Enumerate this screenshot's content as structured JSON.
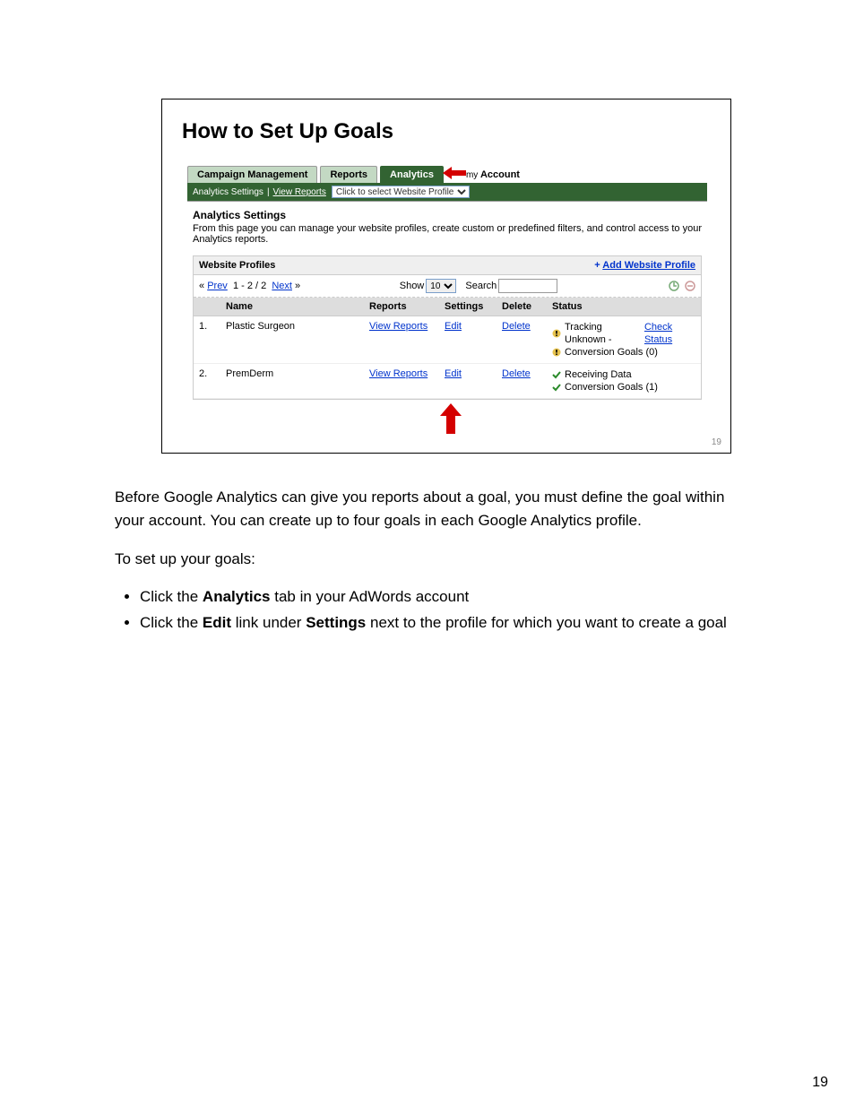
{
  "slide": {
    "title": "How to Set Up Goals",
    "page_label": "19",
    "tabs": [
      "Campaign Management",
      "Reports",
      "Analytics",
      "Account"
    ],
    "active_tab_index": 2,
    "my_prefix": "my",
    "subbar": {
      "settings": "Analytics Settings",
      "view_reports": "View Reports",
      "select_label": "Click to select Website Profile"
    },
    "section": {
      "heading": "Analytics Settings",
      "desc": "From this page you can manage your website profiles, create custom or predefined filters, and control access to your Analytics reports."
    },
    "profiles_table": {
      "header": "Website Profiles",
      "add_link": "Add Website Profile",
      "add_plus": "+",
      "pager": {
        "prev": "Prev",
        "range": "1 - 2 / 2",
        "next": "Next",
        "lq": "«",
        "rq": "»"
      },
      "show_label": "Show",
      "show_value": "10",
      "search_label": "Search",
      "cols": {
        "num": "",
        "name": "Name",
        "reports": "Reports",
        "settings": "Settings",
        "delete": "Delete",
        "status": "Status"
      },
      "rows": [
        {
          "num": "1.",
          "name": "Plastic Surgeon",
          "reports": "View Reports",
          "settings": "Edit",
          "delete": "Delete",
          "status": [
            {
              "kind": "warn",
              "text": "Tracking Unknown -",
              "link": "Check Status"
            },
            {
              "kind": "warn",
              "text": "Conversion Goals (0)"
            }
          ]
        },
        {
          "num": "2.",
          "name": "PremDerm",
          "reports": "View Reports",
          "settings": "Edit",
          "delete": "Delete",
          "status": [
            {
              "kind": "ok",
              "text": "Receiving Data"
            },
            {
              "kind": "ok",
              "text": "Conversion Goals (1)"
            }
          ]
        }
      ]
    }
  },
  "body": {
    "para1": "Before Google Analytics can give you reports about a goal, you must define the goal within your account. You can create up to four goals in each Google Analytics profile.",
    "para2": "To set up your goals:",
    "bullets": [
      {
        "pre": "Click the ",
        "b": "Analytics",
        "post": " tab in your AdWords account"
      },
      {
        "pre": "Click the ",
        "b": "Edit",
        "mid": " link under ",
        "b2": "Settings",
        "post": " next to the profile for which you want to create a goal"
      }
    ]
  },
  "page_number": "19"
}
